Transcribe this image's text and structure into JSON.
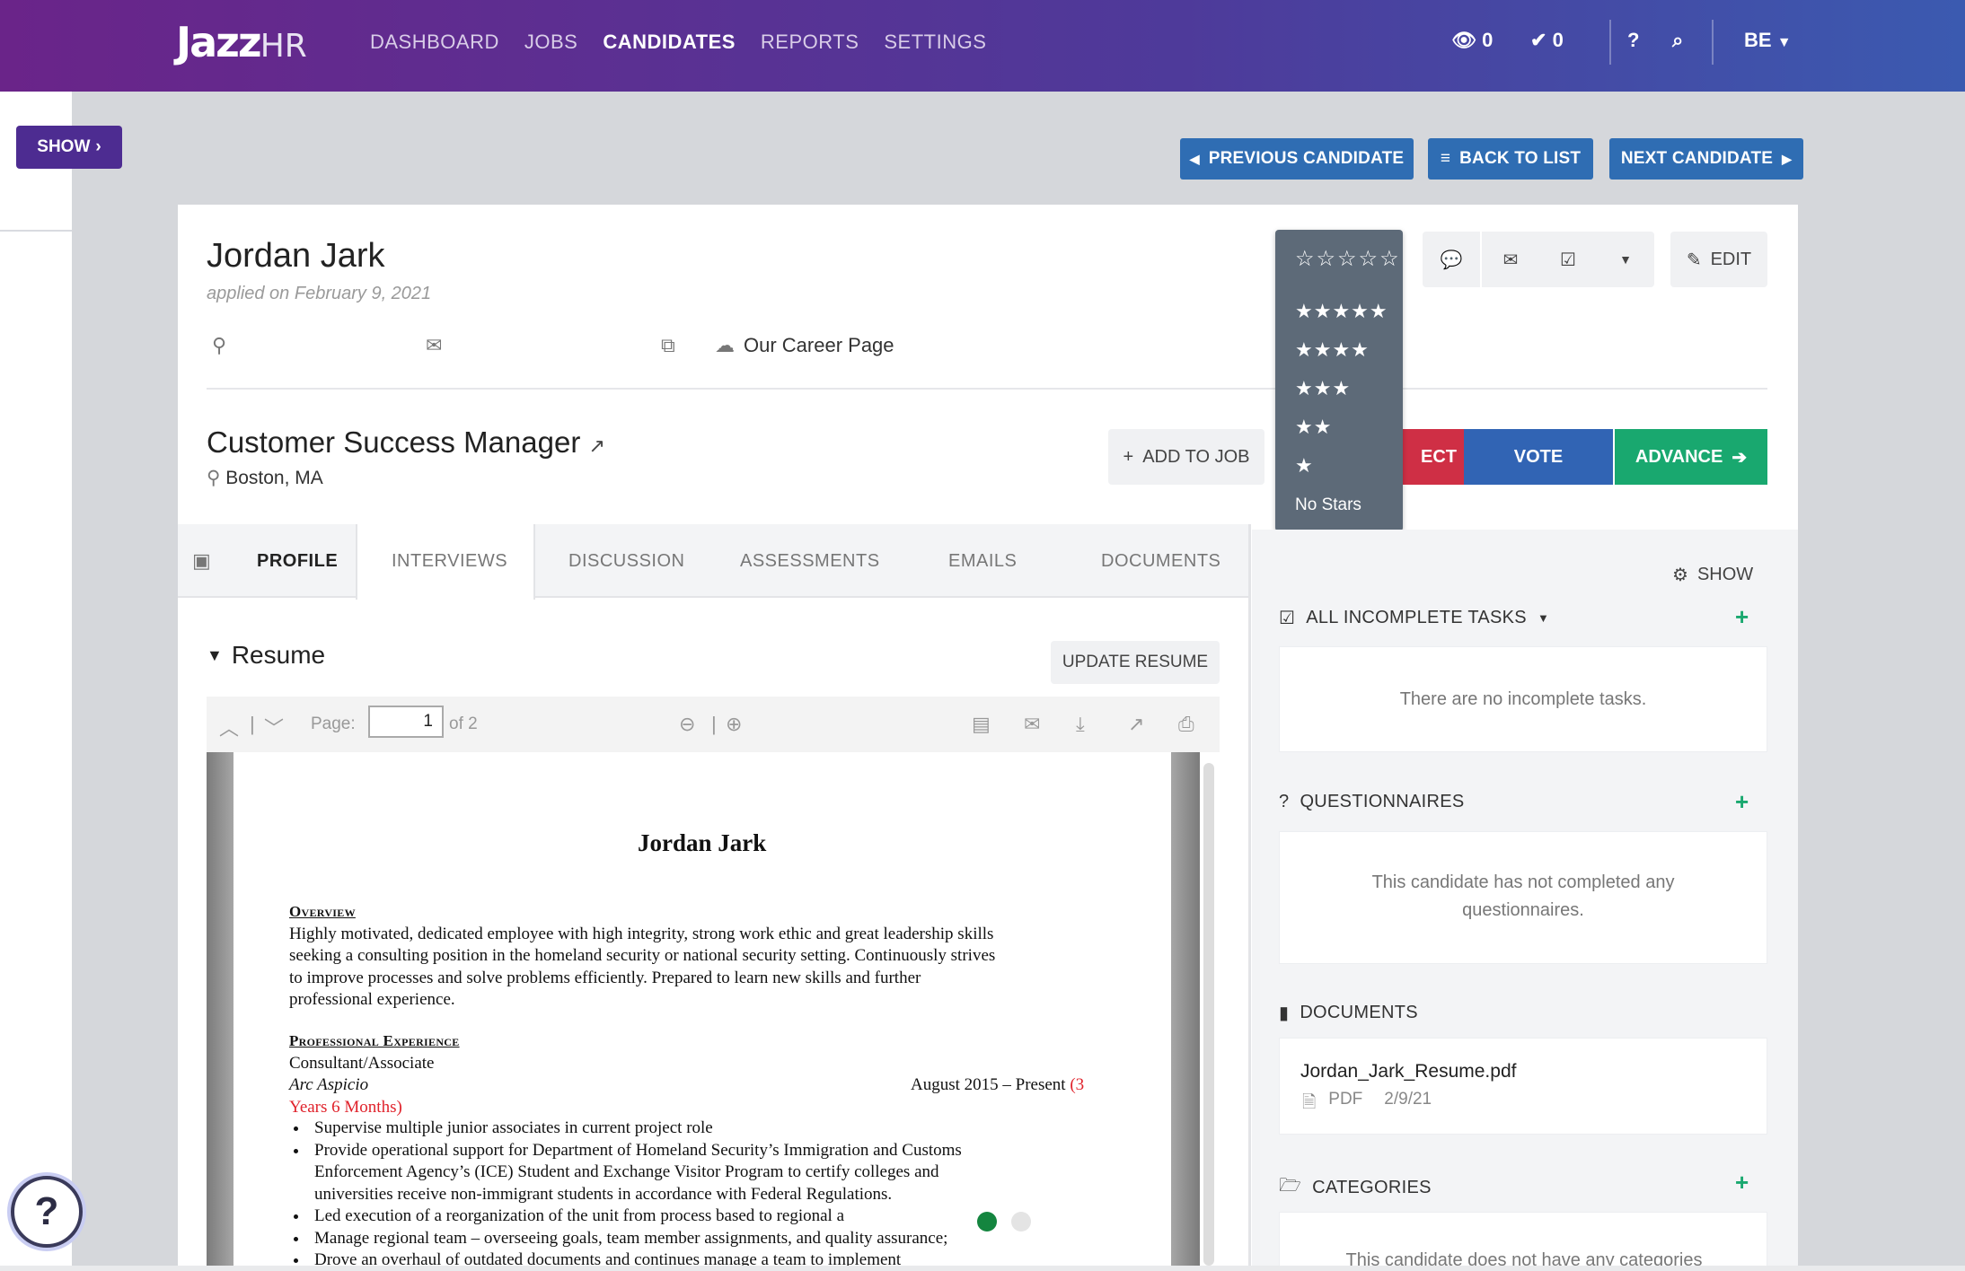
{
  "nav": {
    "logo": "JazzHR",
    "logo_main": "Jazz",
    "logo_hr": "HR",
    "links": [
      "DASHBOARD",
      "JOBS",
      "CANDIDATES",
      "REPORTS",
      "SETTINGS"
    ],
    "active_link": "CANDIDATES",
    "views_count": "0",
    "checks_count": "0",
    "user_initials": "BE"
  },
  "rail": {
    "show_label": "SHOW"
  },
  "pager": {
    "previous_label": "PREVIOUS CANDIDATE",
    "back_label": "BACK TO LIST",
    "next_label": "NEXT CANDIDATE"
  },
  "candidate": {
    "name": "Jordan Jark",
    "applied": "applied on February 9, 2021",
    "source": "Our Career Page"
  },
  "job": {
    "title": "Customer Success Manager",
    "location": "Boston, MA",
    "add_to_job_label": "ADD TO JOB"
  },
  "workflow": {
    "reject_label": "ECT",
    "vote_label": "VOTE",
    "advance_label": "ADVANCE"
  },
  "actions": {
    "edit_label": "EDIT"
  },
  "rating": {
    "current": "☆☆☆☆☆",
    "options": [
      "★★★★★",
      "★★★★",
      "★★★",
      "★★",
      "★",
      "No Stars"
    ]
  },
  "tabs": [
    "PROFILE",
    "INTERVIEWS",
    "DISCUSSION",
    "ASSESSMENTS",
    "EMAILS",
    "DOCUMENTS"
  ],
  "active_tab": "PROFILE",
  "resume": {
    "section_title": "Resume",
    "update_label": "UPDATE RESUME",
    "page_label": "Page:",
    "page_value": "1",
    "page_total": "of 2",
    "doc": {
      "name": "Jordan Jark",
      "overview_heading": "Overview",
      "overview_lines": [
        "Highly motivated, dedicated employee with high integrity, strong work ethic and great leadership skills",
        "seeking a consulting position in the homeland security or national security setting. Continuously strives",
        "to improve processes and solve problems efficiently. Prepared to learn new skills and further",
        "professional experience."
      ],
      "experience_heading": "Professional Experience",
      "role": "Consultant/Associate",
      "company": "Arc Aspicio",
      "dates": "August 2015 – Present",
      "duration_open": "(3",
      "duration_rest": "Years 6 Months)",
      "bullets": [
        "Supervise multiple junior associates in current project role",
        "Provide operational support for Department of Homeland Security’s Immigration and Customs",
        "Enforcement Agency’s (ICE) Student and Exchange Visitor Program to certify colleges and",
        "universities receive non-immigrant students in accordance with Federal Regulations.",
        "Led execution of a reorganization of the unit from process based to regional a",
        "Manage regional team – overseeing goals, team member assignments, and quality assurance;",
        "Drove an overhaul of outdated documents and continues manage a team to implement"
      ]
    }
  },
  "sidebar": {
    "show_label": "SHOW",
    "tasks": {
      "title": "ALL INCOMPLETE TASKS",
      "empty": "There are no incomplete tasks."
    },
    "questionnaires": {
      "title": "QUESTIONNAIRES",
      "empty_line1": "This candidate has not completed any",
      "empty_line2": "questionnaires."
    },
    "documents": {
      "title": "DOCUMENTS",
      "file_name": "Jordan_Jark_Resume.pdf",
      "file_type": "PDF",
      "file_date": "2/9/21"
    },
    "categories": {
      "title": "CATEGORIES",
      "empty": "This candidate does not have any categories"
    }
  },
  "colors": {
    "nav_gradient_start": "#6a2489",
    "nav_gradient_end": "#3b5ab0",
    "primary_blue": "#2f6db3",
    "reject_red": "#cf2f45",
    "vote_blue": "#3164b4",
    "advance_green": "#19a86f"
  }
}
